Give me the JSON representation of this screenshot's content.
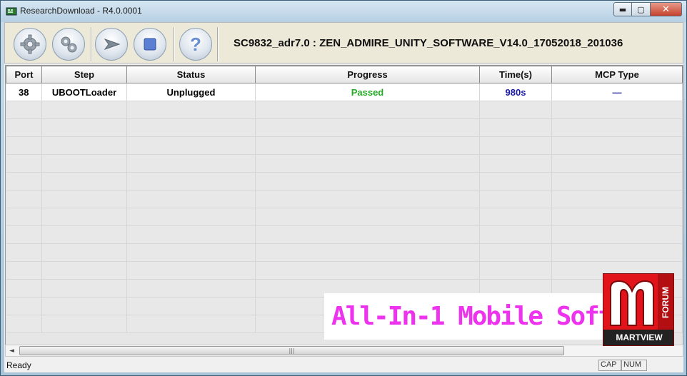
{
  "window": {
    "title": "ResearchDownload - R4.0.0001",
    "minimize": "▬",
    "maximize": "▢",
    "close": "✕"
  },
  "toolbar": {
    "buttons": [
      {
        "icon": "gear-icon",
        "action": "load-packet"
      },
      {
        "icon": "settings-gears-icon",
        "action": "settings"
      },
      {
        "icon": "play-arrow-icon",
        "action": "start-downloading"
      },
      {
        "icon": "stop-square-icon",
        "action": "stop-downloading"
      },
      {
        "icon": "help-question-icon",
        "action": "help"
      }
    ],
    "title": "SC9832_adr7.0 : ZEN_ADMIRE_UNITY_SOFTWARE_V14.0_17052018_201036",
    "help_glyph": "?"
  },
  "grid": {
    "columns": [
      "Port",
      "Step",
      "Status",
      "Progress",
      "Time(s)",
      "MCP Type"
    ],
    "rows": [
      {
        "port": "38",
        "step": "UBOOTLoader",
        "status": "Unplugged",
        "progress": "Passed",
        "time": "980s",
        "mcp": "—"
      }
    ],
    "colors": {
      "progress": "#22aa22",
      "time": "#1a1aa8"
    }
  },
  "watermark": {
    "banner_text": "All-In-1 Mobile Software So",
    "logo_side": "FORUM",
    "logo_bottom": "MARTVIEW"
  },
  "scrollbar": {
    "left_arrow": "◄",
    "grip": "|||"
  },
  "statusbar": {
    "text": "Ready",
    "cap": "CAP",
    "num": "NUM"
  }
}
